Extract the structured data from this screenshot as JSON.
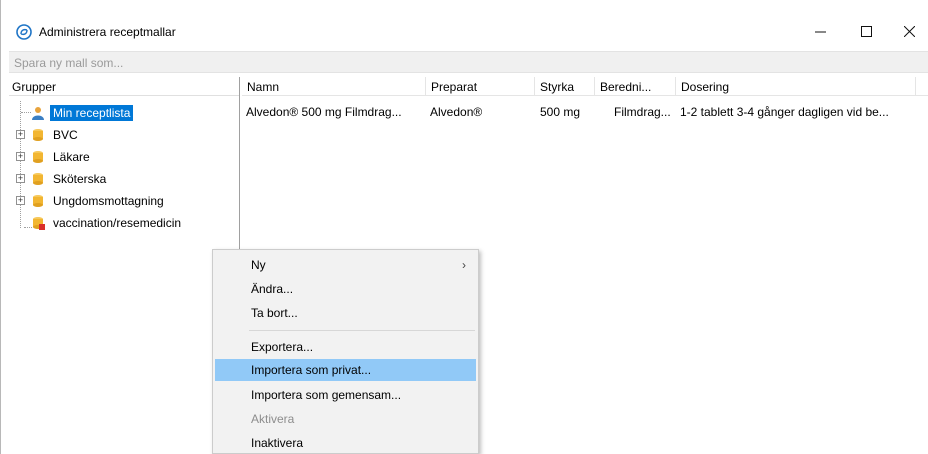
{
  "window": {
    "title": "Administrera receptmallar",
    "minimize_glyph": "—",
    "maximize_glyph": "☐",
    "close_glyph": "✕"
  },
  "save_bar": {
    "placeholder": "Spara ny mall som..."
  },
  "groups": {
    "header": "Grupper",
    "items": [
      {
        "label": "Min receptlista",
        "icon": "user-icon",
        "selected": true,
        "expandable": false
      },
      {
        "label": "BVC",
        "icon": "database-icon",
        "selected": false,
        "expandable": true
      },
      {
        "label": "Läkare",
        "icon": "database-icon",
        "selected": false,
        "expandable": true
      },
      {
        "label": "Sköterska",
        "icon": "database-icon",
        "selected": false,
        "expandable": true
      },
      {
        "label": "Ungdomsmottagning",
        "icon": "database-icon",
        "selected": false,
        "expandable": true
      },
      {
        "label": "vaccination/resemedicin",
        "icon": "database-red-icon",
        "selected": false,
        "expandable": false
      }
    ]
  },
  "table": {
    "columns": [
      "Namn",
      "Preparat",
      "Styrka",
      "Beredni...",
      "Dosering"
    ],
    "rows": [
      [
        "Alvedon® 500 mg Filmdrag...",
        "Alvedon®",
        "500 mg",
        "Filmdrag...",
        "1-2 tablett 3-4 gånger dagligen vid be..."
      ]
    ]
  },
  "context_menu": {
    "items": [
      {
        "label": "Ny",
        "submenu": true
      },
      {
        "label": "Ändra..."
      },
      {
        "label": "Ta bort..."
      },
      {
        "label": "Exportera..."
      },
      {
        "label": "Importera som privat...",
        "highlighted": true
      },
      {
        "label": "Importera som gemensam..."
      },
      {
        "label": "Aktivera",
        "disabled": true
      },
      {
        "label": "Inaktivera"
      }
    ],
    "submenu_arrow": "›"
  },
  "colors": {
    "selection": "#0078d7",
    "menu_highlight": "#91c9f7",
    "db_icon": "#f2b632",
    "user_icon": "#e8a33c",
    "app_icon": "#1e74c6"
  }
}
